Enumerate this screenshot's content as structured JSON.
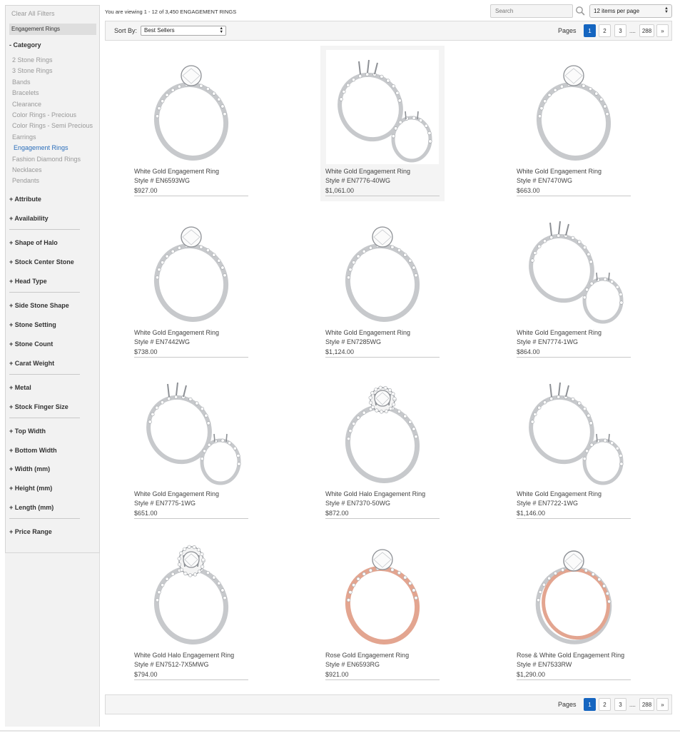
{
  "sidebar": {
    "clear_filters": "Clear All Filters",
    "active_filter": "Engagement Rings",
    "category_heading": "- Category",
    "categories": [
      "2 Stone Rings",
      "3 Stone Rings",
      "Bands",
      "Bracelets",
      "Clearance",
      "Color Rings - Precious",
      "Color Rings - Semi Precious",
      "Earrings",
      "Engagement Rings",
      "Fashion Diamond Rings",
      "Necklaces",
      "Pendants"
    ],
    "active_category": "Engagement Rings",
    "facets": [
      "+ Attribute",
      "+ Availability",
      "+ Shape of Halo",
      "+ Stock Center Stone",
      "+ Head Type",
      "+ Side Stone Shape",
      "+ Stone Setting",
      "+ Stone Count",
      "+ Carat Weight",
      "+ Metal",
      "+ Stock Finger Size",
      "+ Top Width",
      "+ Bottom Width",
      "+ Width (mm)",
      "+ Height (mm)",
      "+ Length (mm)",
      "+ Price Range"
    ]
  },
  "toolbar": {
    "viewing_text": "You are viewing 1 - 12 of 3,450 ENGAGEMENT RINGS",
    "search_placeholder": "Search",
    "per_page": "12 items per page",
    "sort_label": "Sort By:",
    "sort_value": "Best Sellers"
  },
  "pagination": {
    "label": "Pages",
    "pages": [
      "1",
      "2",
      "3"
    ],
    "current": "1",
    "ellipsis": "....",
    "last": "288",
    "next": "»"
  },
  "colors": {
    "accent": "#1565c0",
    "link_active": "#2a6ebb",
    "sidebar_bg": "#f2f2f2",
    "white_gold": "#c7c9cc",
    "rose_gold": "#e3a590"
  },
  "products": [
    {
      "name": "White Gold Engagement Ring",
      "style": "Style # EN6593WG",
      "price": "$927.00",
      "metal": "white",
      "variant": "solitaire"
    },
    {
      "name": "White Gold Engagement Ring",
      "style": "Style # EN7776-40WG",
      "price": "$1,061.00",
      "metal": "white",
      "variant": "semi-mount-pair"
    },
    {
      "name": "White Gold Engagement Ring",
      "style": "Style # EN7470WG",
      "price": "$663.00",
      "metal": "white",
      "variant": "solitaire"
    },
    {
      "name": "White Gold Engagement Ring",
      "style": "Style # EN7442WG",
      "price": "$738.00",
      "metal": "white",
      "variant": "solitaire"
    },
    {
      "name": "White Gold Engagement Ring",
      "style": "Style # EN7285WG",
      "price": "$1,124.00",
      "metal": "white",
      "variant": "solitaire"
    },
    {
      "name": "White Gold Engagement Ring",
      "style": "Style # EN7774-1WG",
      "price": "$864.00",
      "metal": "white",
      "variant": "semi-mount-pair"
    },
    {
      "name": "White Gold Engagement Ring",
      "style": "Style # EN7775-1WG",
      "price": "$651.00",
      "metal": "white",
      "variant": "semi-mount-pair"
    },
    {
      "name": "White Gold Halo Engagement Ring",
      "style": "Style # EN7370-50WG",
      "price": "$872.00",
      "metal": "white",
      "variant": "halo"
    },
    {
      "name": "White Gold Engagement Ring",
      "style": "Style # EN7722-1WG",
      "price": "$1,146.00",
      "metal": "white",
      "variant": "semi-mount-pair"
    },
    {
      "name": "White Gold Halo Engagement Ring",
      "style": "Style # EN7512-7X5MWG",
      "price": "$794.00",
      "metal": "white",
      "variant": "halo-oval"
    },
    {
      "name": "Rose Gold Engagement Ring",
      "style": "Style # EN6593RG",
      "price": "$921.00",
      "metal": "rose",
      "variant": "solitaire"
    },
    {
      "name": "Rose & White Gold Engagement Ring",
      "style": "Style # EN7533RW",
      "price": "$1,290.00",
      "metal": "two-tone",
      "variant": "bypass"
    }
  ]
}
